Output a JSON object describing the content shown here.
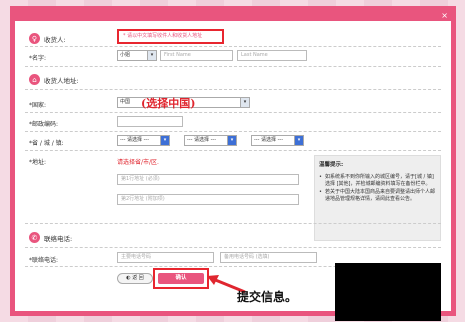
{
  "dialog": {
    "close_label": "×"
  },
  "recipient": {
    "section_title": "收货人:",
    "hint": "* 请以中文填写收件人和收货人地址",
    "name_label": "*名字:",
    "title_select": "小姐",
    "first_name_placeholder": "First Name",
    "last_name_placeholder": "Last Name"
  },
  "address": {
    "section_title": "收货人地址:",
    "country_label": "*国家:",
    "country_value": "中国",
    "country_annotation": "(选择中国)",
    "postal_label": "*邮政编码:",
    "region_label": "*省 / 城 / 镇:",
    "region_placeholder": "--- 请选择 ---",
    "address_label": "*地址:",
    "address_warning": "请选择省/市/区.",
    "line1_placeholder": "第1行地址 (必须)",
    "line2_placeholder": "第2行地址 (附加项)"
  },
  "tips": {
    "title": "温馨提示:",
    "items": [
      "如系统系不到你所输入的城区编号，请于[城 / 镇]选择 [其他]，并检城邮编资料填写在备份栏中。",
      "若关于中国大陆本国商品来自要调整请出师个人邮递地品管理规格详情，请阅此查看公告。"
    ]
  },
  "contact": {
    "section_title": "联络电话:",
    "phone_label": "*联络电话:",
    "primary_placeholder": "主要电话号码",
    "backup_placeholder": "备用电话号码 (选填)"
  },
  "actions": {
    "back_label": "返 回",
    "confirm_label": "确认",
    "submit_annotation": "提交信息。"
  },
  "colors": {
    "accent": "#e9557e",
    "annotation_red": "#e0262f"
  }
}
